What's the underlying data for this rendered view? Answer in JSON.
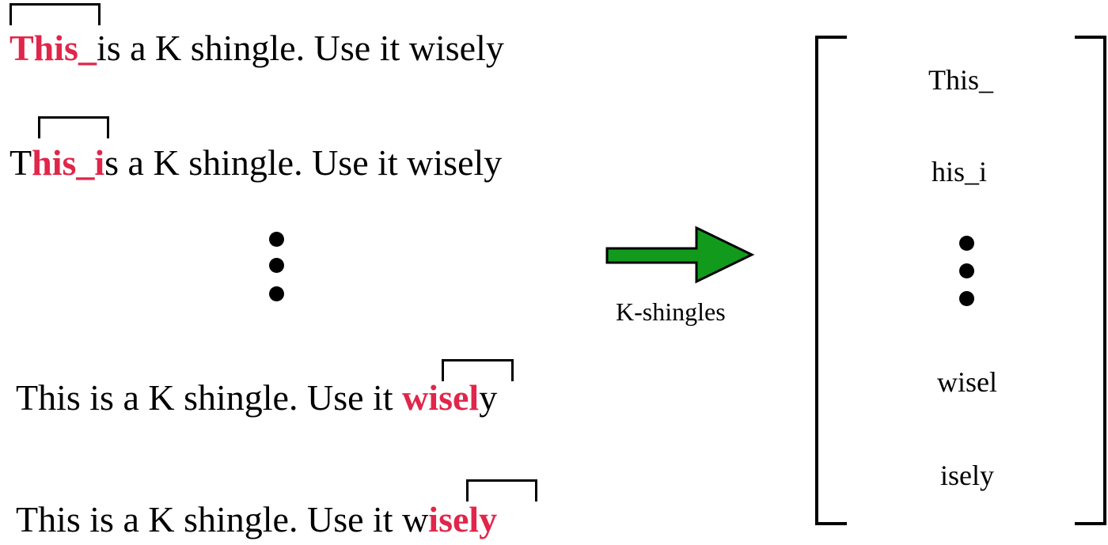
{
  "colors": {
    "highlight": "#e0264a",
    "arrow_fill": "#129a1d",
    "text": "#000000"
  },
  "rows": [
    {
      "pre": "",
      "shingle": "This_",
      "post": "is a K shingle. Use it wisely"
    },
    {
      "pre": "T",
      "shingle": "his_i",
      "post": "s a K shingle. Use it wisely"
    },
    {
      "pre": "This is a K shingle. Use it ",
      "shingle": "wisel",
      "post": "y"
    },
    {
      "pre": "This is a K shingle. Use it w",
      "shingle": "isely",
      "post": ""
    }
  ],
  "arrow": {
    "label": "K-shingles",
    "icon": "right-arrow-icon"
  },
  "shingle_set": {
    "items": [
      "This_",
      "his_i",
      "wisel",
      "isely"
    ]
  }
}
